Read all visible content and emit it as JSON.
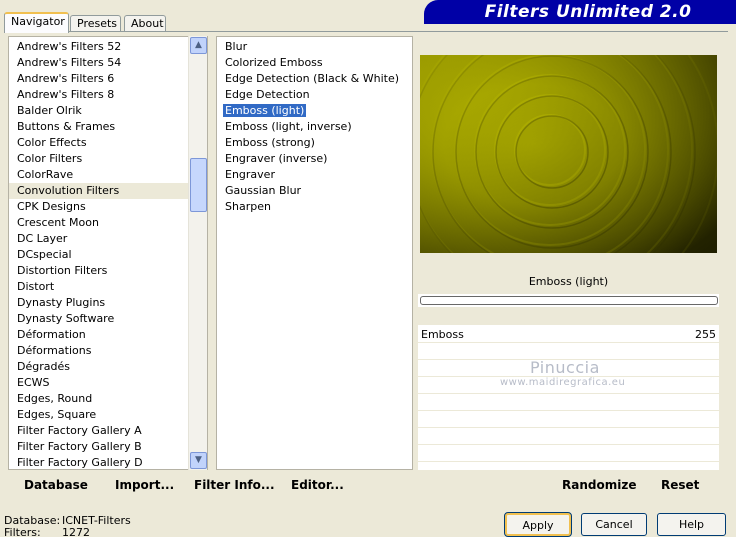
{
  "tabs": [
    "Navigator",
    "Presets",
    "About"
  ],
  "banner_title": "Filters Unlimited 2.0",
  "categories": [
    "Andrew's Filters 52",
    "Andrew's Filters 54",
    "Andrew's Filters 6",
    "Andrew's Filters 8",
    "Balder Olrik",
    "Buttons & Frames",
    "Color Effects",
    "Color Filters",
    "ColorRave",
    "Convolution Filters",
    "CPK Designs",
    "Crescent Moon",
    "DC Layer",
    "DCspecial",
    "Distortion Filters",
    "Distort",
    "Dynasty Plugins",
    "Dynasty Software",
    "Déformation",
    "Déformations",
    "Dégradés",
    "ECWS",
    "Edges, Round",
    "Edges, Square",
    "Filter Factory Gallery A",
    "Filter Factory Gallery B",
    "Filter Factory Gallery D"
  ],
  "selected_category": "Convolution Filters",
  "filters": [
    "Blur",
    "Colorized Emboss",
    "Edge Detection (Black & White)",
    "Edge Detection",
    "Emboss (light)",
    "Emboss (light, inverse)",
    "Emboss (strong)",
    "Engraver (inverse)",
    "Engraver",
    "Gaussian Blur",
    "Sharpen"
  ],
  "selected_filter": "Emboss (light)",
  "filter_name": "Emboss (light)",
  "progress": 0,
  "params": [
    {
      "label": "Emboss",
      "value": "255"
    }
  ],
  "watermark": {
    "line1": "Pinuccia",
    "line2": "www.maidiregrafica.eu"
  },
  "toolbar": {
    "database": "Database",
    "import": "Import...",
    "filter_info": "Filter Info...",
    "editor": "Editor...",
    "randomize": "Randomize",
    "reset": "Reset"
  },
  "status": {
    "database_label": "Database:",
    "database_value": "ICNET-Filters",
    "filters_label": "Filters:",
    "filters_value": "1272"
  },
  "buttons": {
    "apply": "Apply",
    "cancel": "Cancel",
    "help": "Help"
  },
  "colors": {
    "accent": "#0000a6",
    "selection": "#316ac5",
    "preview": "#9a9a00"
  }
}
